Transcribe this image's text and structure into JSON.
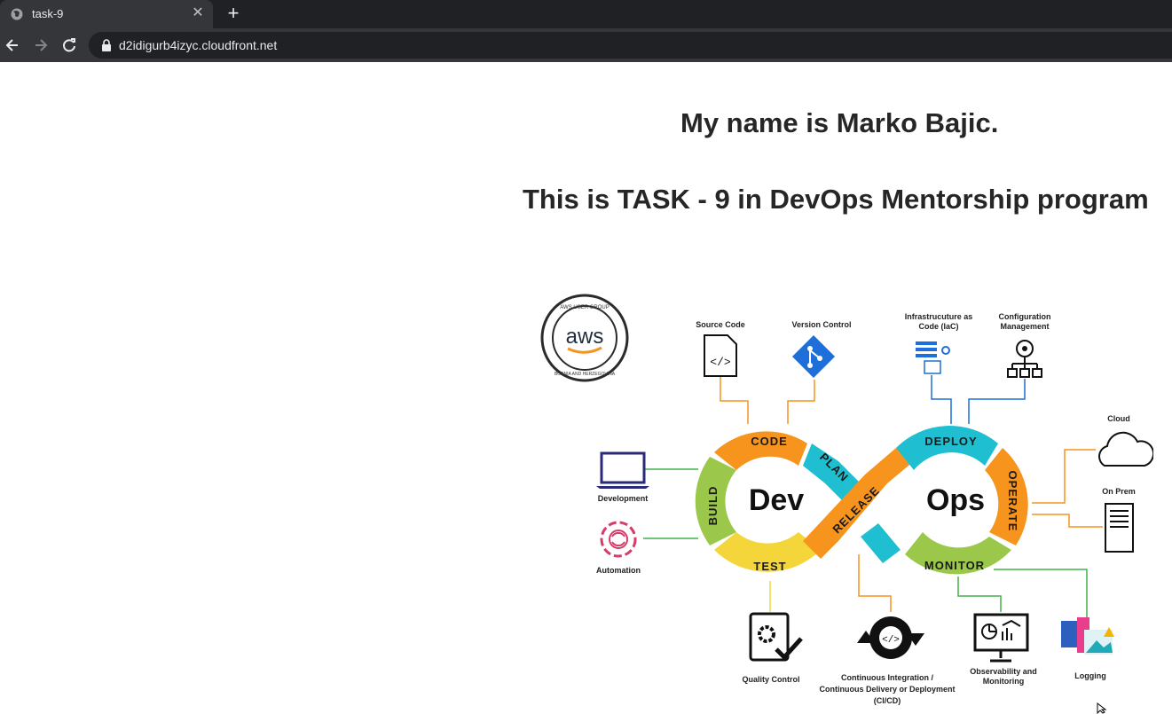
{
  "browser": {
    "tab_title": "task-9",
    "url": "d2idigurb4izyc.cloudfront.net"
  },
  "page": {
    "heading_name": "My name is Marko Bajic.",
    "heading_task": "This is TASK - 9 in DevOps Mentorship program"
  },
  "diagram": {
    "badge": {
      "top_text": "AWS USER GROUP",
      "logo_text": "aws",
      "bottom_text": "BOSNIA AND HERZEGOVINA"
    },
    "center_left": "Dev",
    "center_right": "Ops",
    "segments": {
      "code": "CODE",
      "plan": "PLAN",
      "build": "BUILD",
      "test": "TEST",
      "release": "RELEASE",
      "deploy": "DEPLOY",
      "operate": "OPERATE",
      "monitor": "MONITOR"
    },
    "labels": {
      "source_code": "Source Code",
      "version_control": "Version Control",
      "iac_line1": "Infrastrucuture as",
      "iac_line2": "Code (IaC)",
      "config_line1": "Configuration",
      "config_line2": "Management",
      "cloud": "Cloud",
      "on_prem": "On Prem",
      "development": "Development",
      "automation": "Automation",
      "quality_control": "Quality Control",
      "ci_line1": "Continuous Integration /",
      "ci_line2": "Continuous Delivery or Deployment",
      "ci_line3": "(CI/CD)",
      "observability_line1": "Observability and",
      "observability_line2": "Monitoring",
      "logging": "Logging"
    },
    "colors": {
      "orange": "#f7941d",
      "cyan": "#1fbfd1",
      "green": "#9bc84a",
      "yellow": "#f4d53a",
      "blue": "#1e6fd9",
      "line_green": "#3fb24b"
    }
  }
}
